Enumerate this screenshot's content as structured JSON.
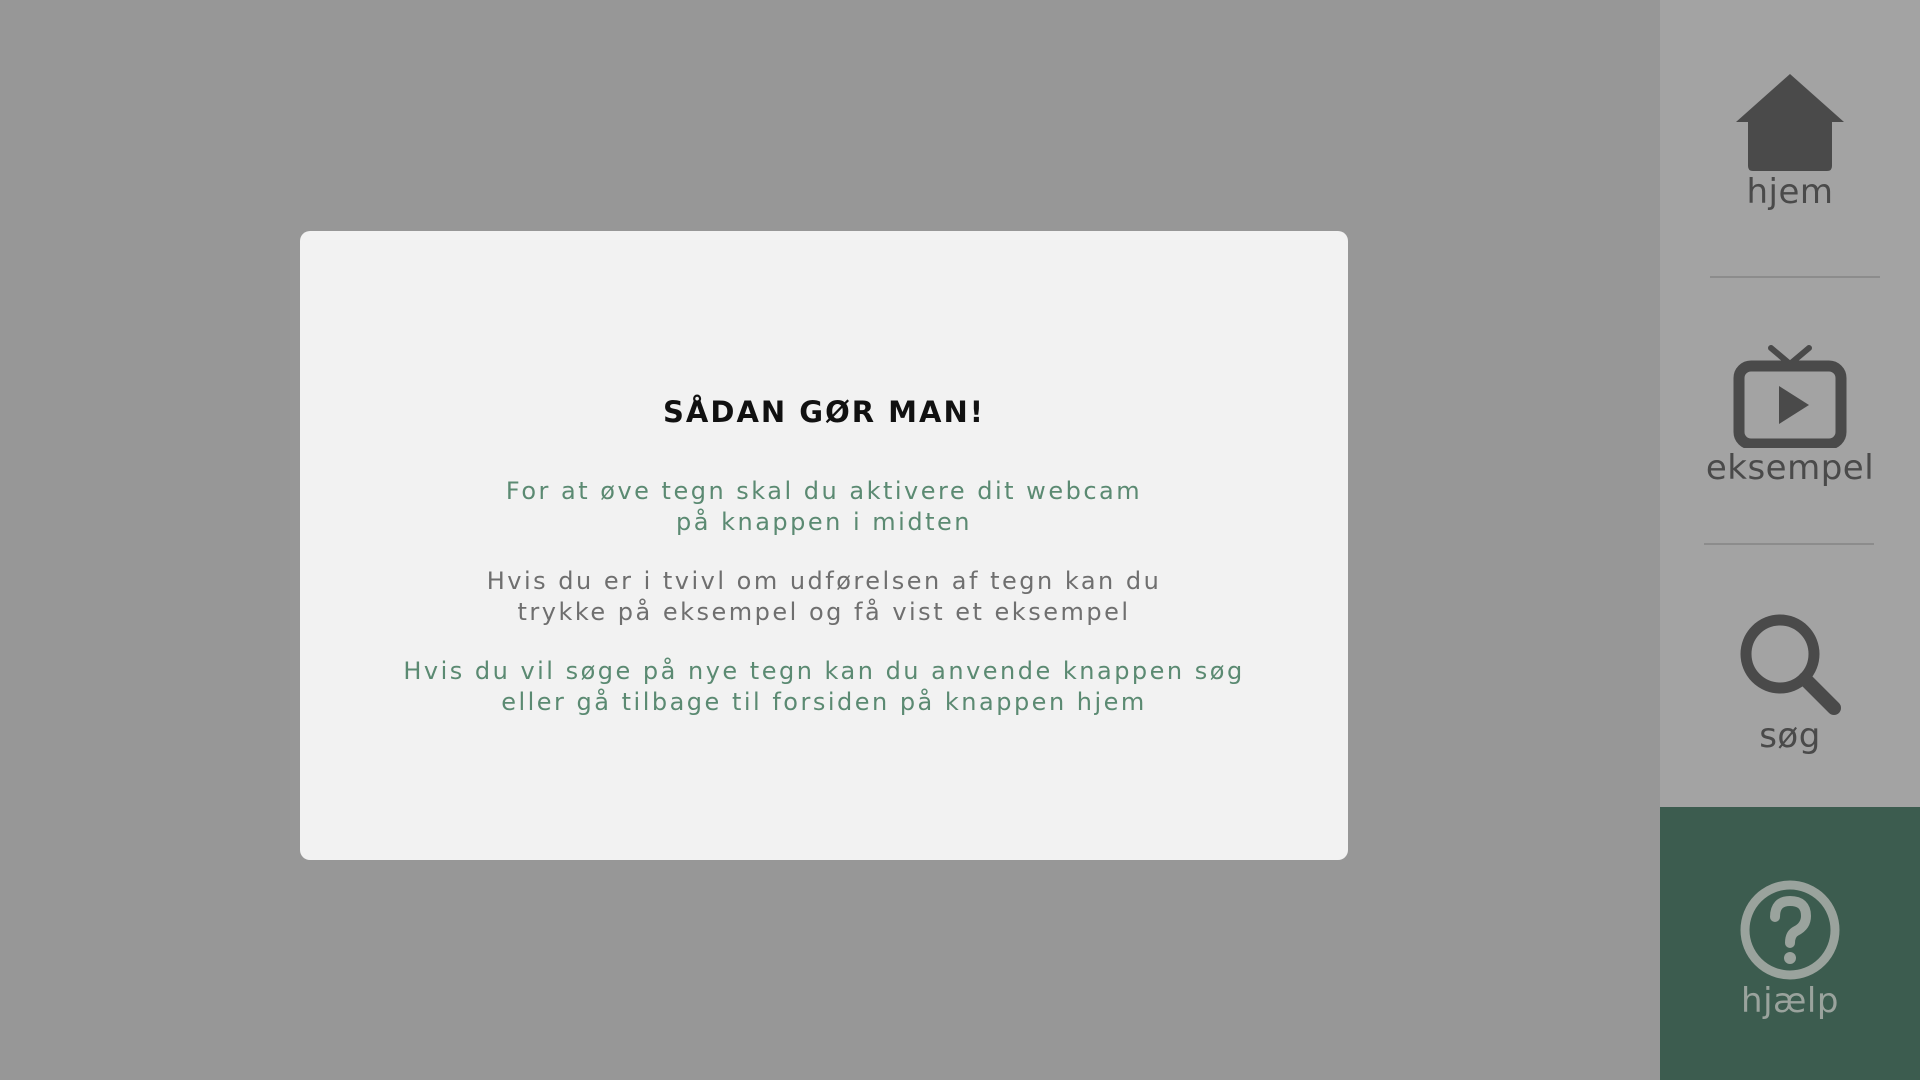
{
  "modal": {
    "title": "SÅDAN GØR MAN!",
    "paragraph1": [
      "For at øve tegn skal du aktivere dit webcam",
      "på knappen i midten"
    ],
    "paragraph2": [
      "Hvis du er i tvivl om udførelsen af tegn kan du",
      "trykke på eksempel og få vist et eksempel"
    ],
    "paragraph3": [
      "Hvis du vil søge på nye tegn kan du anvende knappen søg",
      "eller gå tilbage til forsiden på knappen hjem"
    ]
  },
  "sidebar": {
    "items": [
      {
        "label": "hjem",
        "icon": "home-icon"
      },
      {
        "label": "eksempel",
        "icon": "tv-play-icon"
      },
      {
        "label": "søg",
        "icon": "search-icon"
      },
      {
        "label": "hjælp",
        "icon": "question-circle-icon",
        "active": true
      }
    ]
  },
  "colors": {
    "backdrop": "#979797",
    "modal_bg": "#f2f2f2",
    "accent_green": "#5b8a72",
    "active_bg": "#3c5c4f",
    "icon_gray": "#4a4a4a"
  }
}
